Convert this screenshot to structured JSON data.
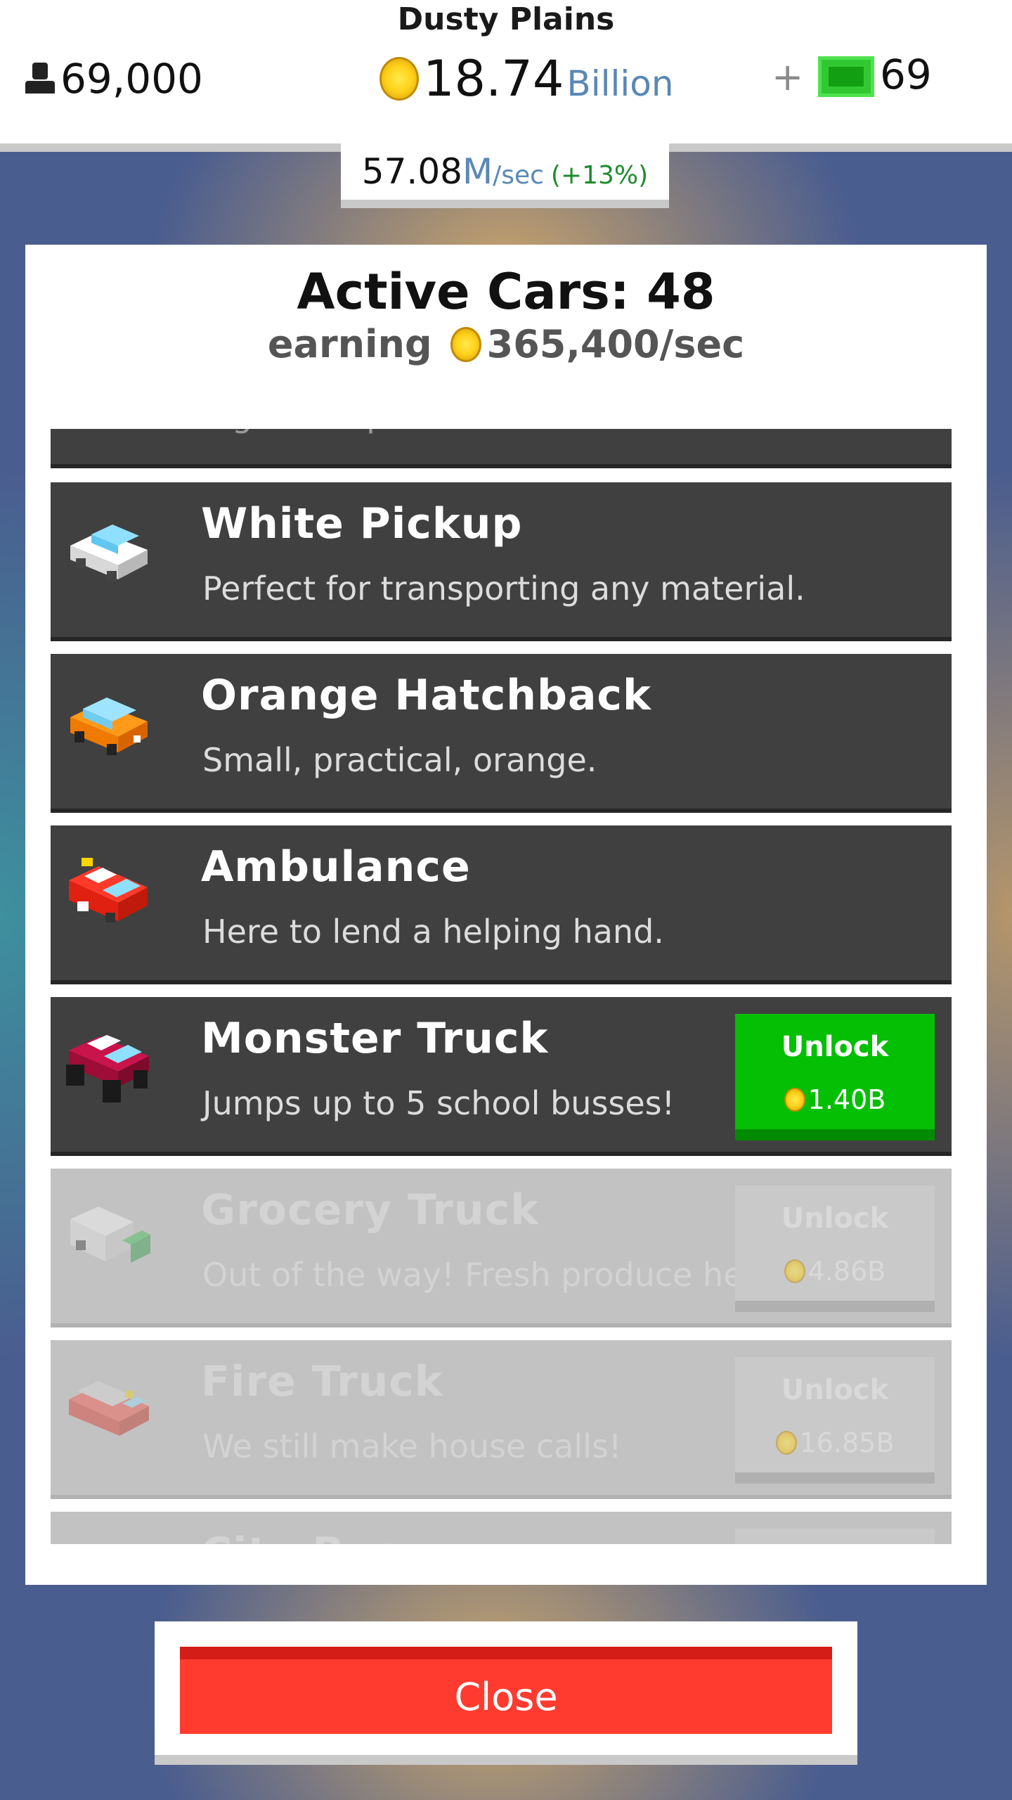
{
  "header": {
    "map_name": "Dusty Plains",
    "population": "69,000",
    "money_value": "18.74",
    "money_unit": "Billion",
    "plus": "+",
    "cash": "69"
  },
  "rate": {
    "value": "57.08",
    "unit": "M",
    "per_sec": "/sec",
    "boost": "(+13%)"
  },
  "panel": {
    "title": "Active Cars: 48",
    "earning_label": "earning",
    "earning_value": "365,400/sec"
  },
  "cars": [
    {
      "name": "",
      "desc": "Sign here please!",
      "locked": false
    },
    {
      "name": "White Pickup",
      "desc": "Perfect for transporting any material.",
      "locked": false
    },
    {
      "name": "Orange Hatchback",
      "desc": "Small, practical, orange.",
      "locked": false
    },
    {
      "name": "Ambulance",
      "desc": "Here to lend a helping hand.",
      "locked": false
    },
    {
      "name": "Monster Truck",
      "desc": "Jumps up to 5 school busses!",
      "locked": false,
      "unlock_label": "Unlock",
      "price": "1.40B"
    },
    {
      "name": "Grocery Truck",
      "desc": "Out of the way! Fresh produce here!",
      "locked": true,
      "unlock_label": "Unlock",
      "price": "4.86B"
    },
    {
      "name": "Fire Truck",
      "desc": "We still make house calls!",
      "locked": true,
      "unlock_label": "Unlock",
      "price": "16.85B"
    },
    {
      "name": "City Bus",
      "desc": "",
      "locked": true
    }
  ],
  "colors": {
    "unlock_green": "#05bf05",
    "close_red": "#ff3b2f",
    "row_dark": "#404040",
    "row_locked": "#c2c2c2",
    "unit_blue": "#5a88b5"
  },
  "close_label": "Close"
}
